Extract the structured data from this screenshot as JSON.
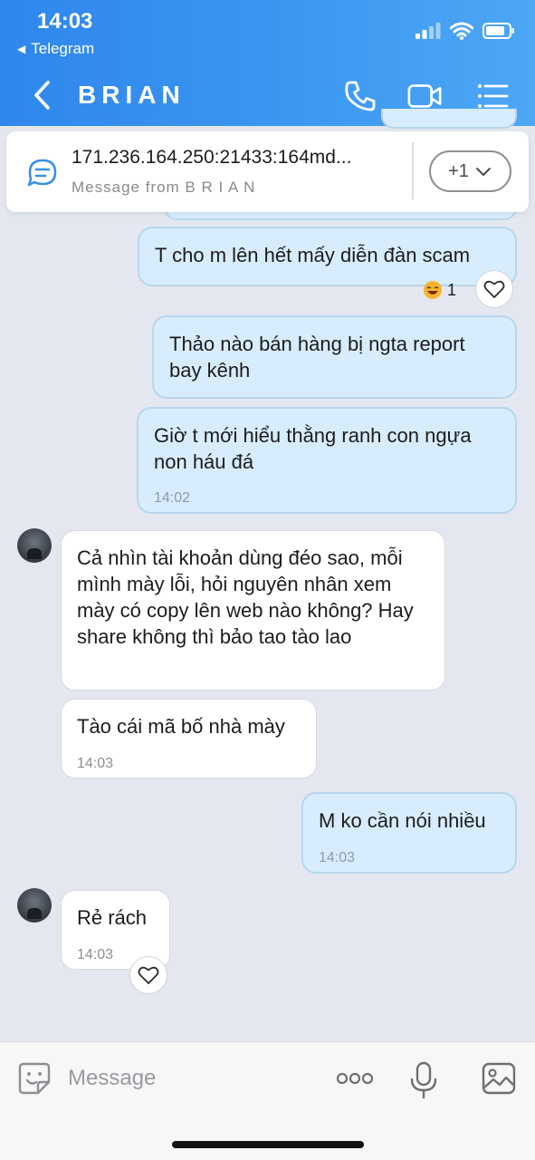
{
  "status_bar": {
    "time": "14:03",
    "back_app": "Telegram"
  },
  "nav": {
    "title": "BRIAN"
  },
  "pinned": {
    "text": "171.236.164.250:21433:164md...",
    "subtitle": "Message from B R I A N",
    "more_label": "+1"
  },
  "messages": [
    {
      "id": "m1",
      "text": "T cho m lên hết mấy diễn đàn scam",
      "direction": "out",
      "reaction_count": "1"
    },
    {
      "id": "m2",
      "text": "Thảo nào bán hàng bị ngta report bay kênh",
      "direction": "out"
    },
    {
      "id": "m3",
      "text": "Giờ t mới hiểu thằng ranh con ngựa non háu đá",
      "direction": "out",
      "time": "14:02"
    },
    {
      "id": "m4",
      "text": "Cả nhìn tài khoản dùng đéo sao, mỗi mình mày lỗi, hỏi nguyên nhân xem mày có copy lên web nào không? Hay share không thì bảo tao tào lao",
      "direction": "in"
    },
    {
      "id": "m5",
      "text": "Tào cái mã bố nhà mày",
      "direction": "in",
      "time": "14:03"
    },
    {
      "id": "m6",
      "text": "M ko cần nói nhiều",
      "direction": "out",
      "time": "14:03"
    },
    {
      "id": "m7",
      "text": "Rẻ rách",
      "direction": "in",
      "time": "14:03"
    }
  ],
  "input": {
    "placeholder": "Message"
  },
  "colors": {
    "header_start": "#2f87ec",
    "header_end": "#4ea7f5",
    "out_bubble": "#d7edfd",
    "in_bubble": "#ffffff",
    "chat_bg": "#e4e7f0"
  },
  "icons": [
    "wifi-icon",
    "battery-icon",
    "phone-icon",
    "video-icon",
    "menu-icon",
    "chat-bubble-icon",
    "chevron-down-icon",
    "sticker-icon",
    "more-icon",
    "mic-icon",
    "image-icon",
    "heart-icon"
  ]
}
